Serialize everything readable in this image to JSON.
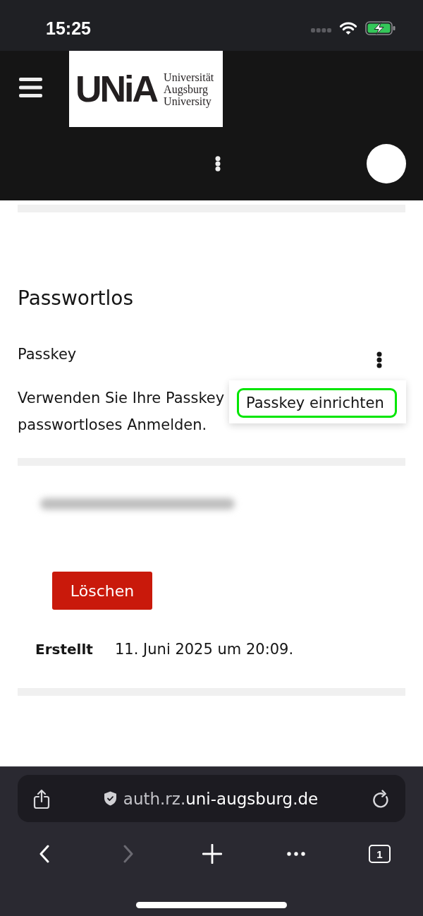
{
  "status_bar": {
    "time": "15:25"
  },
  "header": {
    "logo": {
      "mark": "UNiA",
      "lines": [
        "Universität",
        "Augsburg",
        "University"
      ]
    }
  },
  "section": {
    "title": "Passwortlos",
    "item": {
      "title": "Passkey",
      "description_lines": [
        "Verwenden Sie Ihre Passkey",
        "passwortloses Anmelden."
      ],
      "menu": {
        "open": true,
        "items": [
          {
            "label": "Passkey einrichten",
            "focused": true
          }
        ]
      }
    }
  },
  "credential": {
    "delete_button": "Löschen",
    "created_label": "Erstellt",
    "created_value": "11. Juni 2025 um 20:09."
  },
  "browser": {
    "url": {
      "prefix": "auth.rz.",
      "domain": "uni-augsburg.de"
    },
    "toolbar": [
      {
        "kind": "back",
        "disabled": false
      },
      {
        "kind": "forward",
        "disabled": true
      },
      {
        "kind": "new_tab",
        "disabled": false
      },
      {
        "kind": "more",
        "disabled": false
      },
      {
        "kind": "tabs",
        "label": "1",
        "disabled": false
      }
    ]
  }
}
